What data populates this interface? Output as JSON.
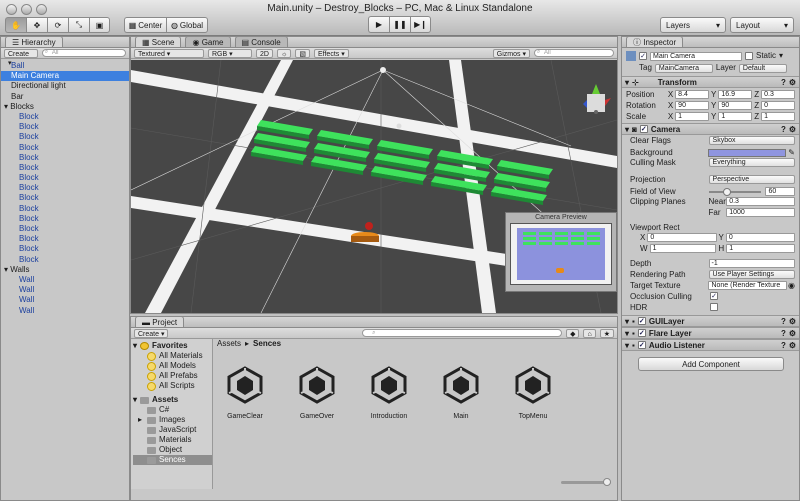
{
  "window": {
    "title": "Main.unity – Destroy_Blocks – PC, Mac & Linux Standalone"
  },
  "toolbar": {
    "center": "Center",
    "global": "Global",
    "layers": "Layers",
    "layout": "Layout"
  },
  "hierarchy": {
    "tab": "Hierarchy",
    "create": "Create",
    "search_placeholder": "All",
    "rows": [
      "Ball",
      "Main Camera",
      "Directional light",
      "Bar",
      "Blocks",
      "Block",
      "Block",
      "Block",
      "Block",
      "Block",
      "Block",
      "Block",
      "Block",
      "Block",
      "Block",
      "Block",
      "Block",
      "Block",
      "Block",
      "Block",
      "Walls",
      "Wall",
      "Wall",
      "Wall",
      "Wall"
    ]
  },
  "scene": {
    "tabs": [
      "Scene",
      "Game",
      "Console"
    ],
    "shading": "Textured",
    "render": "RGB",
    "mode2d": "2D",
    "effects": "Effects",
    "gizmos": "Gizmos",
    "search_placeholder": "All",
    "camera_preview": "Camera Preview"
  },
  "project": {
    "tab": "Project",
    "create": "Create",
    "favorites_label": "Favorites",
    "favorites": [
      "All Materials",
      "All Models",
      "All Prefabs",
      "All Scripts"
    ],
    "assets_label": "Assets",
    "folders": [
      "C#",
      "Images",
      "JavaScript",
      "Materials",
      "Object",
      "Sences"
    ],
    "breadcrumb": {
      "root": "Assets",
      "current": "Sences"
    },
    "scenes": [
      "GameClear",
      "GameOver",
      "Introduction",
      "Main",
      "TopMenu"
    ]
  },
  "inspector": {
    "tab": "Inspector",
    "object_name": "Main Camera",
    "static_label": "Static",
    "tag_label": "Tag",
    "tag": "MainCamera",
    "layer_label": "Layer",
    "layer": "Default",
    "transform": {
      "title": "Transform",
      "position_label": "Position",
      "rotation_label": "Rotation",
      "scale_label": "Scale",
      "pos": {
        "x": "8.4",
        "y": "16.9",
        "z": "0.3"
      },
      "rot": {
        "x": "90",
        "y": "90",
        "z": "0"
      },
      "scale": {
        "x": "1",
        "y": "1",
        "z": "1"
      }
    },
    "camera": {
      "title": "Camera",
      "clear_flags_label": "Clear Flags",
      "clear_flags": "Skybox",
      "background_label": "Background",
      "background_color": "#8f95e0",
      "culling_label": "Culling Mask",
      "culling": "Everything",
      "projection_label": "Projection",
      "projection": "Perspective",
      "fov_label": "Field of View",
      "fov": "60",
      "fov_fraction": 0.34,
      "clipping_label": "Clipping Planes",
      "near_label": "Near",
      "near": "0.3",
      "far_label": "Far",
      "far": "1000",
      "viewport_label": "Viewport Rect",
      "vp": {
        "x": "0",
        "y": "0",
        "w": "1",
        "h": "1"
      },
      "depth_label": "Depth",
      "depth": "-1",
      "rendering_path_label": "Rendering Path",
      "rendering_path": "Use Player Settings",
      "target_texture_label": "Target Texture",
      "target_texture": "None (Render Texture",
      "occlusion_label": "Occlusion Culling",
      "hdr_label": "HDR"
    },
    "components": [
      "GUILayer",
      "Flare Layer",
      "Audio Listener"
    ],
    "add_component": "Add Component"
  },
  "colors": {
    "selection": "#3d80df",
    "block_green": "#3ee25c",
    "scene_bg": "#474747"
  }
}
